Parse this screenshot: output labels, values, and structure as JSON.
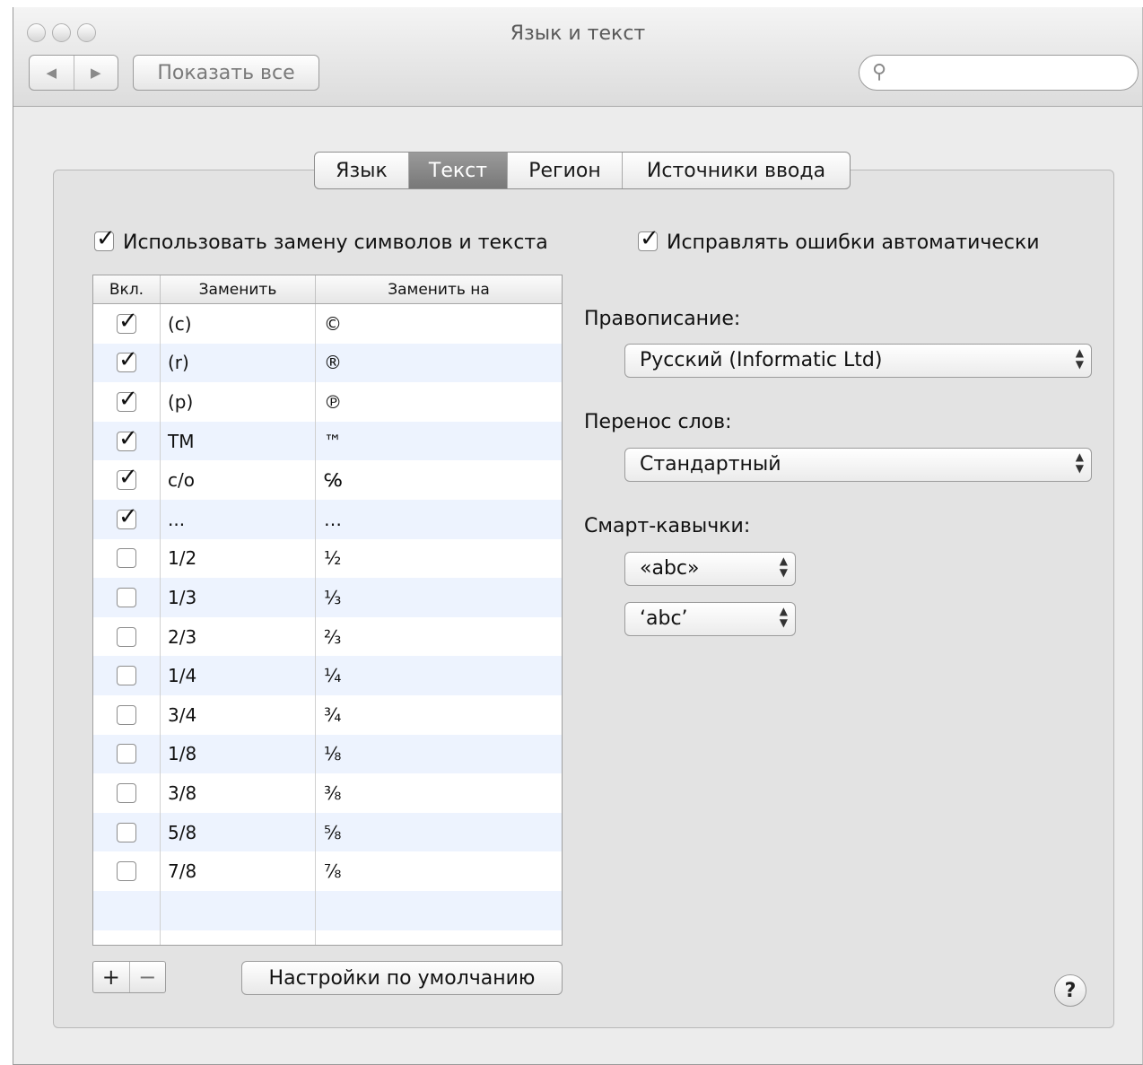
{
  "window": {
    "title": "Язык и текст"
  },
  "toolbar": {
    "back_icon": "◀",
    "forward_icon": "▶",
    "show_all_label": "Показать все",
    "search_placeholder": ""
  },
  "tabs": [
    {
      "label": "Язык",
      "active": false
    },
    {
      "label": "Текст",
      "active": true
    },
    {
      "label": "Регион",
      "active": false
    },
    {
      "label": "Источники ввода",
      "active": false
    }
  ],
  "replace": {
    "enable_label": "Использовать замену символов и текста",
    "enabled": true,
    "columns": {
      "on": "Вкл.",
      "replace": "Заменить",
      "with": "Заменить на"
    },
    "rows": [
      {
        "on": true,
        "replace": "(c)",
        "with": "©"
      },
      {
        "on": true,
        "replace": "(r)",
        "with": "®"
      },
      {
        "on": true,
        "replace": "(p)",
        "with": "℗"
      },
      {
        "on": true,
        "replace": "TM",
        "with": "™"
      },
      {
        "on": true,
        "replace": "c/o",
        "with": "℅"
      },
      {
        "on": true,
        "replace": "...",
        "with": "…"
      },
      {
        "on": false,
        "replace": "1/2",
        "with": "½"
      },
      {
        "on": false,
        "replace": "1/3",
        "with": "⅓"
      },
      {
        "on": false,
        "replace": "2/3",
        "with": "⅔"
      },
      {
        "on": false,
        "replace": "1/4",
        "with": "¼"
      },
      {
        "on": false,
        "replace": "3/4",
        "with": "¾"
      },
      {
        "on": false,
        "replace": "1/8",
        "with": "⅛"
      },
      {
        "on": false,
        "replace": "3/8",
        "with": "⅜"
      },
      {
        "on": false,
        "replace": "5/8",
        "with": "⅝"
      },
      {
        "on": false,
        "replace": "7/8",
        "with": "⅞"
      }
    ],
    "add_label": "+",
    "remove_label": "−",
    "defaults_label": "Настройки по умолчанию"
  },
  "spelling": {
    "autocorrect_label": "Исправлять ошибки автоматически",
    "autocorrect": true,
    "spelling_label": "Правописание:",
    "spelling_value": "Русский (Informatic Ltd)",
    "hyphen_label": "Перенос слов:",
    "hyphen_value": "Стандартный",
    "quotes_label": "Смарт-кавычки:",
    "double_quotes_value": "«abc»",
    "single_quotes_value": "‘abc’"
  },
  "help_label": "?"
}
